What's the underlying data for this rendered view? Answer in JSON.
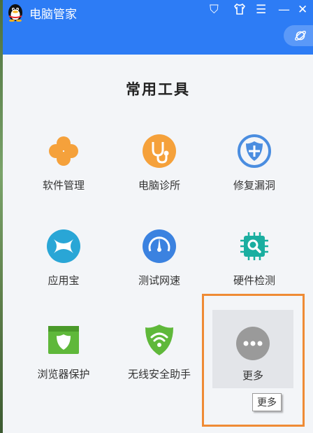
{
  "app": {
    "title": "电脑管家"
  },
  "titlebar_buttons": [
    {
      "name": "shield",
      "glyph": "⛉"
    },
    {
      "name": "skin",
      "glyph": "👕"
    },
    {
      "name": "menu",
      "glyph": "☰"
    },
    {
      "name": "minimize",
      "glyph": "—"
    },
    {
      "name": "close",
      "glyph": "✕"
    }
  ],
  "section": {
    "title": "常用工具"
  },
  "tools": [
    {
      "label": "软件管理",
      "icon": "clover-icon",
      "color": "#f5a13b"
    },
    {
      "label": "电脑诊所",
      "icon": "stethoscope-icon",
      "color": "#f5a13b"
    },
    {
      "label": "修复漏洞",
      "icon": "repair-shield-icon",
      "color": "#4a8de0"
    },
    {
      "label": "应用宝",
      "icon": "app-store-icon",
      "color": "#29a6d6"
    },
    {
      "label": "测试网速",
      "icon": "speedometer-icon",
      "color": "#3b82e0"
    },
    {
      "label": "硬件检测",
      "icon": "chip-search-icon",
      "color": "#1aaea0"
    },
    {
      "label": "浏览器保护",
      "icon": "browser-shield-icon",
      "color": "#5fb83a"
    },
    {
      "label": "无线安全助手",
      "icon": "wifi-shield-icon",
      "color": "#5fb83a"
    }
  ],
  "more": {
    "label": "更多",
    "tooltip": "更多",
    "icon": "more-dots-icon",
    "color": "#9a9a9a"
  },
  "highlight_color": "#ef8b35",
  "accent": "#2d7cf5"
}
